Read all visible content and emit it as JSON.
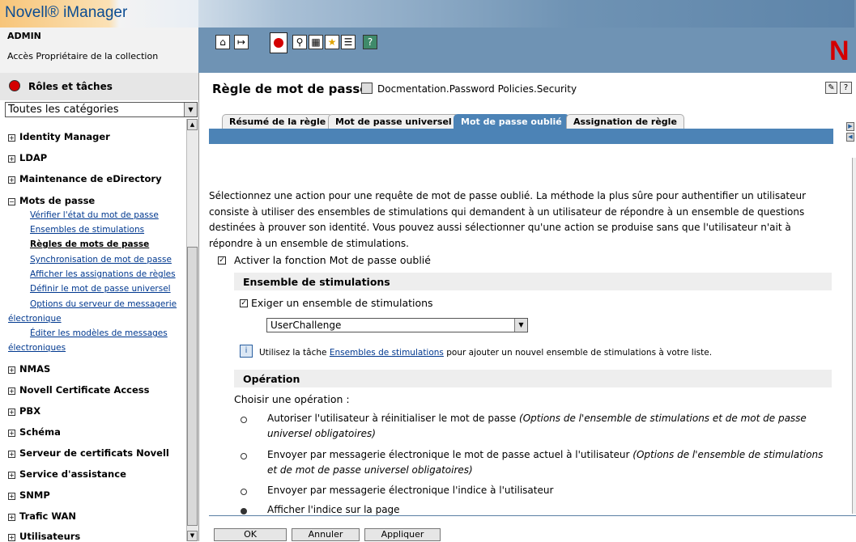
{
  "app": {
    "title": "Novell® iManager",
    "brand_color": "#6f93b4",
    "accent_red": "#d40000"
  },
  "header": {
    "user": "ADMIN",
    "access": "Accès Propriétaire de la collection",
    "toolbar_icons": [
      "home-icon",
      "exit-icon",
      "roles-tasks-icon",
      "view-objects-icon",
      "configure-icon",
      "favorites-icon",
      "preferences-icon",
      "help-icon"
    ],
    "corner_logo": "N"
  },
  "sidebar": {
    "title": "Rôles et tâches",
    "category_select": "Toutes les catégories",
    "categories": [
      {
        "label": "Identity Manager",
        "sign": "+"
      },
      {
        "label": "LDAP",
        "sign": "+"
      },
      {
        "label": "Maintenance de eDirectory",
        "sign": "+"
      },
      {
        "label": "Mots de passe",
        "sign": "−"
      },
      {
        "label": "NMAS",
        "sign": "+"
      },
      {
        "label": "Novell Certificate Access",
        "sign": "+"
      },
      {
        "label": "PBX",
        "sign": "+"
      },
      {
        "label": "Schéma",
        "sign": "+"
      },
      {
        "label": "Serveur de certificats Novell",
        "sign": "+"
      },
      {
        "label": "Service d'assistance",
        "sign": "+"
      },
      {
        "label": "SNMP",
        "sign": "+"
      },
      {
        "label": "Trafic WAN",
        "sign": "+"
      },
      {
        "label": "Utilisateurs",
        "sign": "+"
      }
    ],
    "password_tasks": [
      "Vérifier l'état du mot de passe",
      "Ensembles de stimulations",
      "Règles de mots de passe",
      "Synchronisation de mot de passe",
      "Afficher les assignations de règles",
      "Définir le mot de passe universel",
      "Options du serveur de messagerie",
      "électronique",
      "Éditer les modèles de messages",
      "électroniques"
    ]
  },
  "main": {
    "title": "Règle de mot de passe:",
    "policy_path": "Docmentation.Password Policies.Security",
    "tabs": [
      "Résumé de la règle",
      "Mot de passe universel",
      "Mot de passe oublié",
      "Assignation de règle"
    ],
    "active_tab": "Mot de passe oublié",
    "description": "Sélectionnez une action pour une requête de mot de passe oublié. La méthode la plus sûre pour authentifier un utilisateur consiste à utiliser des ensembles de stimulations qui demandent à un utilisateur de répondre à un ensemble de questions destinées à prouver son identité. Vous pouvez aussi sélectionner qu'une action se produise sans que l'utilisateur n'ait à répondre à un ensemble de stimulations.",
    "enable_label": "Activer la fonction Mot de passe oublié",
    "enable_checked": true,
    "challenge_section": "Ensemble de stimulations",
    "require_label": "Exiger un ensemble de stimulations",
    "require_checked": true,
    "challenge_value": "UserChallenge",
    "info_pre": "Utilisez la tâche",
    "info_link": "Ensembles de stimulations",
    "info_post": "pour ajouter un nouvel ensemble de stimulations à votre liste.",
    "operation_section": "Opération",
    "choose_label": "Choisir une opération :",
    "operations": [
      {
        "text": "Autoriser l'utilisateur à réinitialiser le mot de passe",
        "note": "(Options de l'ensemble de stimulations et de mot de passe universel obligatoires)",
        "selected": false
      },
      {
        "text": "Envoyer par messagerie électronique le mot de passe actuel à l'utilisateur",
        "note": "(Options de l'ensemble de stimulations et de mot de passe universel obligatoires)",
        "selected": false
      },
      {
        "text": "Envoyer par messagerie électronique l'indice à l'utilisateur",
        "note": "",
        "selected": false
      },
      {
        "text": "Afficher l'indice sur la page",
        "note": "",
        "selected": true
      }
    ]
  },
  "buttons": {
    "ok": "OK",
    "cancel": "Annuler",
    "apply": "Appliquer"
  }
}
